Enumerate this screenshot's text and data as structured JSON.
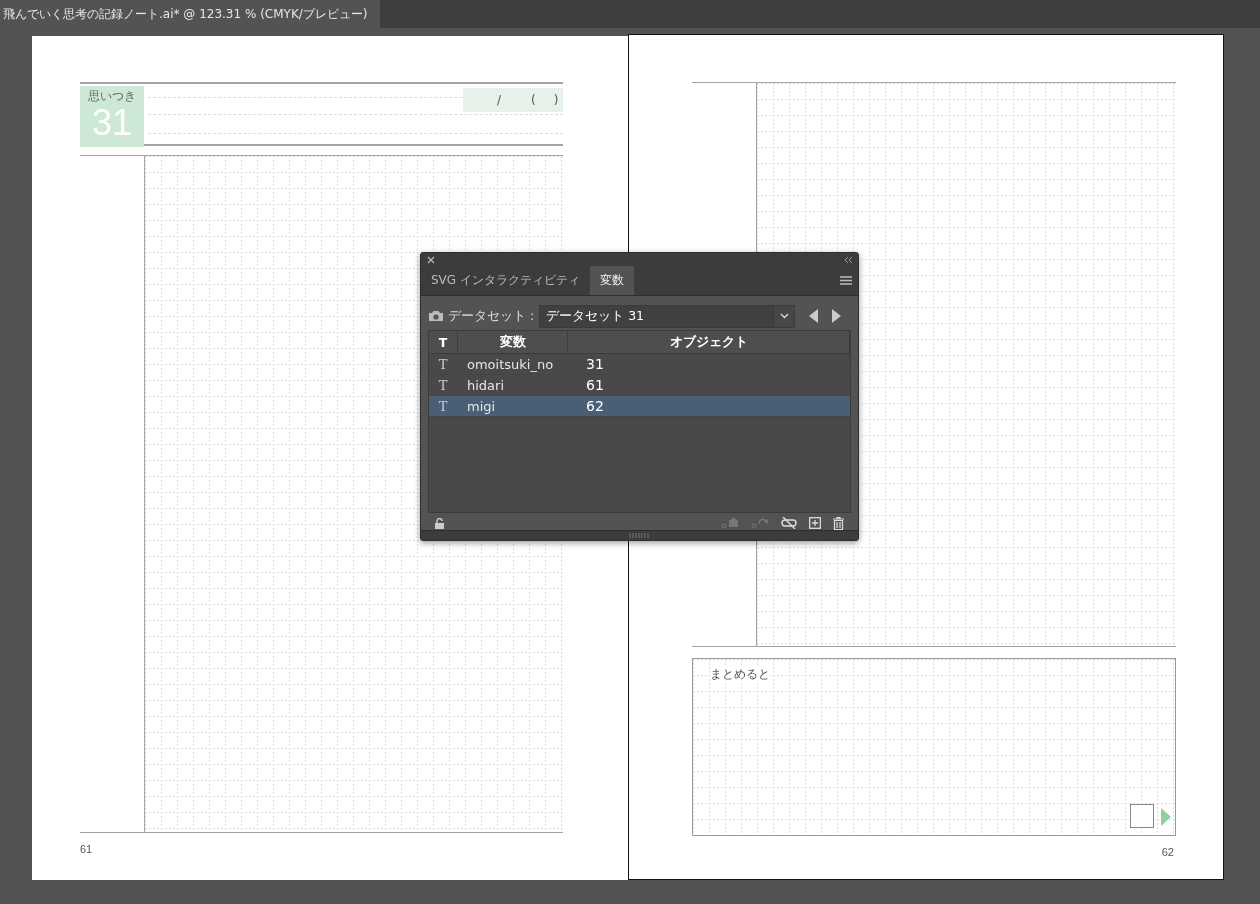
{
  "window": {
    "title": "飛んでいく思考の記録ノート.ai* @ 123.31 % (CMYK/プレビュー)"
  },
  "left_page": {
    "header_label": "思いつき",
    "header_number": "31",
    "date_marks": [
      "/",
      "(",
      ")"
    ],
    "page_number": "61"
  },
  "right_page": {
    "summary_label": "まとめると",
    "checked": false,
    "page_number": "62"
  },
  "panel": {
    "tabs": [
      {
        "label": "SVG インタラクティビティ",
        "selected": false
      },
      {
        "label": "変数",
        "selected": true
      }
    ],
    "dataset_label": "データセット :",
    "dataset_value": "データセット 31",
    "columns": [
      "T",
      "変数",
      "オブジェクト"
    ],
    "rows": [
      {
        "type_icon": "T",
        "variable": "omoitsuki_no",
        "object": "31",
        "selected": false
      },
      {
        "type_icon": "T",
        "variable": "hidari",
        "object": "61",
        "selected": false
      },
      {
        "type_icon": "T",
        "variable": "migi",
        "object": "62",
        "selected": true
      }
    ],
    "tools": [
      {
        "kind": "capture",
        "disabled": true
      },
      {
        "kind": "update",
        "disabled": true
      },
      {
        "kind": "unlink",
        "disabled": false
      },
      {
        "kind": "new",
        "disabled": false
      },
      {
        "kind": "delete",
        "disabled": false
      }
    ]
  }
}
